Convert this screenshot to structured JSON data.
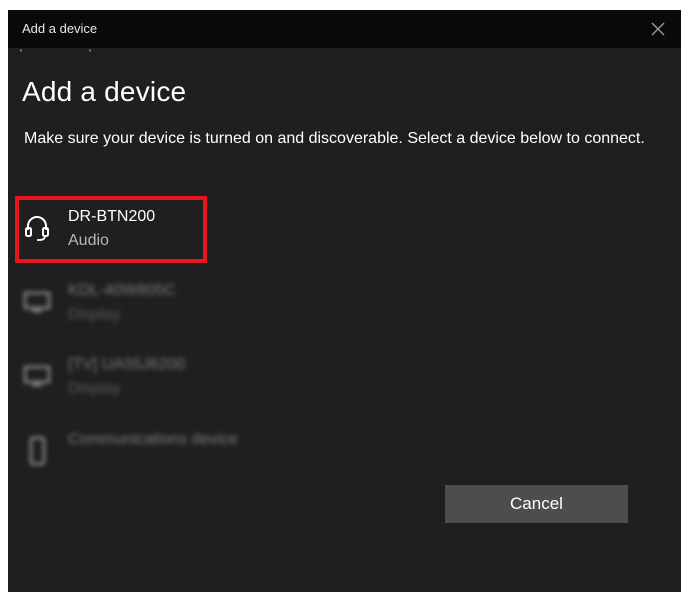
{
  "window": {
    "title": "Add a device",
    "close_icon": "close-icon"
  },
  "main": {
    "heading": "Add a device",
    "description": "Make sure your device is turned on and discoverable. Select a device below to connect."
  },
  "devices": [
    {
      "name": "DR-BTN200",
      "type": "Audio",
      "icon": "headphones-icon",
      "highlighted": true,
      "blurred": false
    },
    {
      "name": "KDL-40W805C",
      "type": "Display",
      "icon": "monitor-icon",
      "highlighted": false,
      "blurred": true
    },
    {
      "name": "[TV] UA55J6200",
      "type": "Display",
      "icon": "monitor-icon",
      "highlighted": false,
      "blurred": true
    },
    {
      "name": "Communications device",
      "type": "",
      "icon": "phone-icon",
      "highlighted": false,
      "blurred": true
    }
  ],
  "buttons": {
    "cancel_label": "Cancel"
  },
  "colors": {
    "background": "#1f1f1f",
    "titlebar": "#0a0a0a",
    "highlight": "#e8151b",
    "button": "#4d4d4d"
  }
}
